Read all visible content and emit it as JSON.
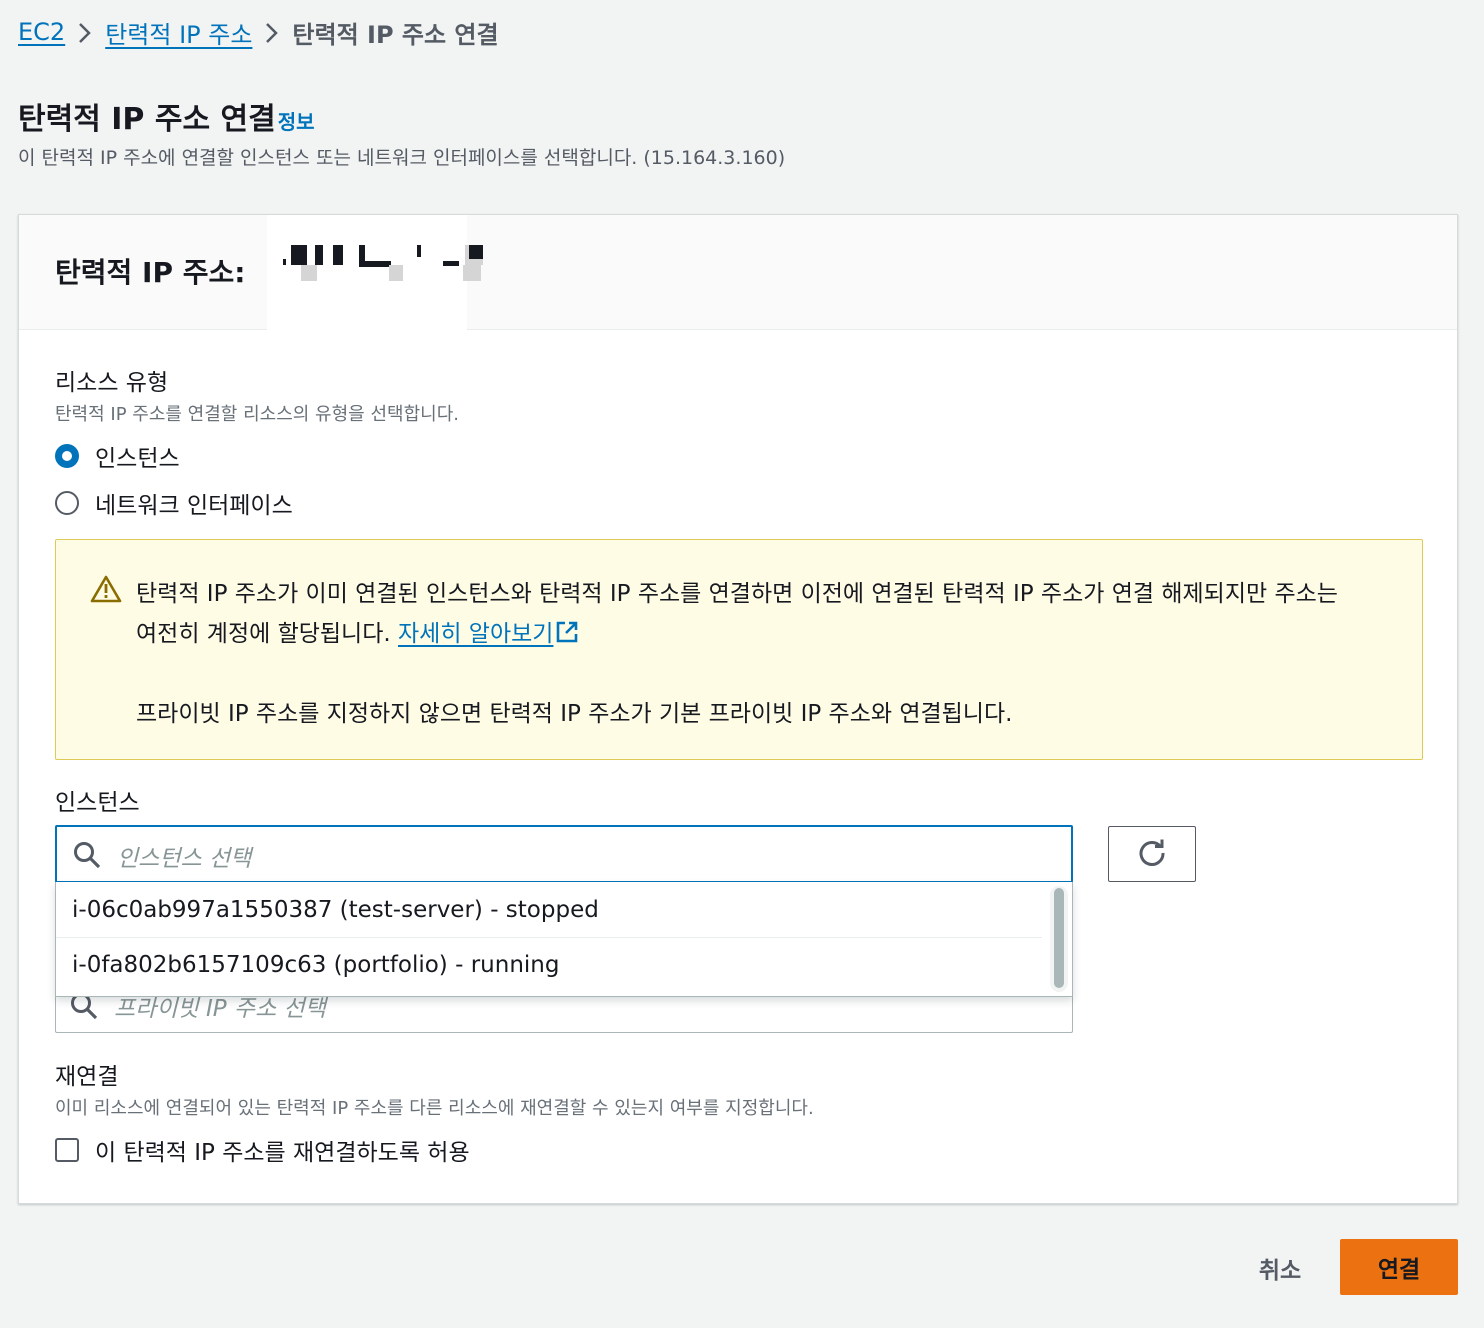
{
  "breadcrumb": {
    "items": [
      "EC2",
      "탄력적 IP 주소"
    ],
    "current": "탄력적 IP 주소 연결"
  },
  "page": {
    "title": "탄력적 IP 주소 연결",
    "info_link": "정보",
    "description": "이 탄력적 IP 주소에 연결할 인스턴스 또는 네트워크 인터페이스를 선택합니다. (15.164.3.160)"
  },
  "panel": {
    "title_prefix": "탄력적 IP 주소:"
  },
  "resource_type": {
    "label": "리소스 유형",
    "description": "탄력적 IP 주소를 연결할 리소스의 유형을 선택합니다.",
    "options": [
      "인스턴스",
      "네트워크 인터페이스"
    ],
    "selected": "인스턴스"
  },
  "alert": {
    "line1": "탄력적 IP 주소가 이미 연결된 인스턴스와 탄력적 IP 주소를 연결하면 이전에 연결된 탄력적 IP 주소가 연결 해제되지만 주소는",
    "line2": "여전히 계정에 할당됩니다. ",
    "link": "자세히 알아보기",
    "line3": "프라이빗 IP 주소를 지정하지 않으면 탄력적 IP 주소가 기본 프라이빗 IP 주소와 연결됩니다."
  },
  "instance": {
    "label": "인스턴스",
    "placeholder": "인스턴스 선택",
    "options": [
      "i-06c0ab997a1550387 (test-server) - stopped",
      "i-0fa802b6157109c63 (portfolio) - running"
    ]
  },
  "private_ip": {
    "placeholder": "프라이빗 IP 주소 선택"
  },
  "reassociation": {
    "label": "재연결",
    "description": "이미 리소스에 연결되어 있는 탄력적 IP 주소를 다른 리소스에 재연결할 수 있는지 여부를 지정합니다.",
    "checkbox_label": "이 탄력적 IP 주소를 재연결하도록 허용",
    "checked": false
  },
  "footer": {
    "cancel": "취소",
    "submit": "연결"
  },
  "colors": {
    "link": "#0073bb",
    "primary": "#ec7211",
    "alert_bg": "#fffce6",
    "alert_border": "#e0ca57"
  }
}
